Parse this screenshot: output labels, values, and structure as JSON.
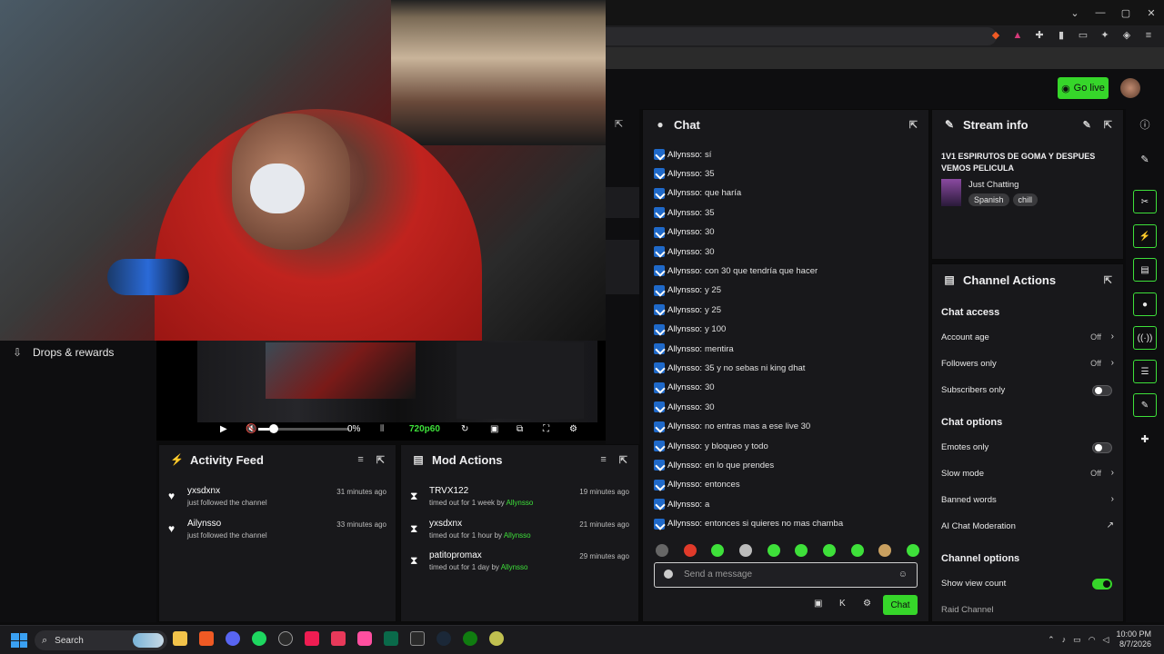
{
  "header": {
    "go_live_label": "Go live"
  },
  "left": {
    "drops_label": "Drops & rewards"
  },
  "player": {
    "volume_pct": "0%",
    "quality": "720p60"
  },
  "activity_feed": {
    "title": "Activity Feed",
    "items": [
      {
        "name": "yxsdxnx",
        "detail": "just followed the channel",
        "time": "31 minutes ago"
      },
      {
        "name": "Ailynsso",
        "detail": "just followed the channel",
        "time": "33 minutes ago"
      }
    ]
  },
  "mod_actions": {
    "title": "Mod Actions",
    "items": [
      {
        "name": "TRVX122",
        "detail": "timed out for 1 week by",
        "by": "Allynsso",
        "time": "19 minutes ago"
      },
      {
        "name": "yxsdxnx",
        "detail": "timed out for 1 hour by",
        "by": "Allynsso",
        "time": "21 minutes ago"
      },
      {
        "name": "patitopromax",
        "detail": "timed out for 1 day by",
        "by": "Allynsso",
        "time": "29 minutes ago"
      }
    ]
  },
  "chat": {
    "title": "Chat",
    "messages": [
      {
        "user": "Allynsso:",
        "text": "sí"
      },
      {
        "user": "Allynsso:",
        "text": "35"
      },
      {
        "user": "Allynsso:",
        "text": "que haría"
      },
      {
        "user": "Allynsso:",
        "text": "35"
      },
      {
        "user": "Allynsso:",
        "text": "30"
      },
      {
        "user": "Allynsso:",
        "text": "30"
      },
      {
        "user": "Allynsso:",
        "text": "con 30 que tendría que hacer"
      },
      {
        "user": "Allynsso:",
        "text": "y 25"
      },
      {
        "user": "Allynsso:",
        "text": "y 25"
      },
      {
        "user": "Allynsso:",
        "text": "y 100"
      },
      {
        "user": "Allynsso:",
        "text": "mentira"
      },
      {
        "user": "Allynsso:",
        "text": "35 y no sebas ni king dhat"
      },
      {
        "user": "Allynsso:",
        "text": "30"
      },
      {
        "user": "Allynsso:",
        "text": "30"
      },
      {
        "user": "Allynsso:",
        "text": "no entras mas a ese live 30"
      },
      {
        "user": "Allynsso:",
        "text": "y bloqueo y todo"
      },
      {
        "user": "Allynsso:",
        "text": "en lo que prendes"
      },
      {
        "user": "Allynsso:",
        "text": "entonces"
      },
      {
        "user": "Allynsso:",
        "text": "a"
      },
      {
        "user": "Allynsso:",
        "text": "entonces si quieres no mas chamba"
      }
    ],
    "input_placeholder": "Send a message",
    "send_label": "Chat"
  },
  "stream_info": {
    "title": "Stream info",
    "stream_title": "1V1 ESPIRUTOS DE GOMA Y DESPUES VEMOS PELICULA",
    "category": "Just Chatting",
    "tags": [
      "Spanish",
      "chill"
    ]
  },
  "channel_actions": {
    "title": "Channel Actions",
    "chat_access_heading": "Chat access",
    "account_age_label": "Account age",
    "account_age_value": "Off",
    "followers_only_label": "Followers only",
    "followers_only_value": "Off",
    "subscribers_only_label": "Subscribers only",
    "chat_options_heading": "Chat options",
    "emotes_only_label": "Emotes only",
    "slow_mode_label": "Slow mode",
    "slow_mode_value": "Off",
    "banned_words_label": "Banned words",
    "ai_moderation_label": "AI Chat Moderation",
    "channel_options_heading": "Channel options",
    "show_view_count_label": "Show view count",
    "raid_channel_label": "Raid Channel"
  },
  "taskbar": {
    "search_label": "Search",
    "time": "10:00 PM",
    "date": "8/7/2026"
  },
  "colors": {
    "accent": "#36d62a",
    "panel": "#18181b",
    "badge": "#1f69c9"
  }
}
